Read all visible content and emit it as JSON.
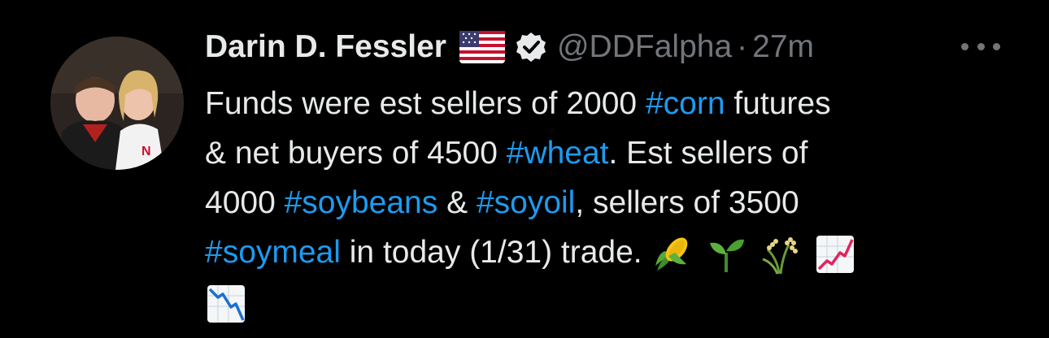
{
  "author": {
    "name": "Darin D. Fessler",
    "handle": "@DDFalpha",
    "separator": "·",
    "time": "27m"
  },
  "icons": {
    "flag": "us-flag-icon",
    "verified": "verified-badge-icon",
    "more": "more-options-icon",
    "emoji": [
      "ear-of-corn",
      "seedling",
      "sheaf-of-rice",
      "chart-increasing",
      "chart-decreasing"
    ]
  },
  "colors": {
    "background": "#000000",
    "text": "#e7e9ea",
    "secondary": "#71767b",
    "hashtag": "#1d9bf0"
  },
  "tweet": {
    "line1": {
      "text_a": "Funds were est sellers of 2000 ",
      "tag_a": "#corn",
      "text_b": " futures"
    },
    "line2": {
      "text_a": "& net buyers of 4500 ",
      "tag_a": "#wheat",
      "text_b": ". Est sellers of"
    },
    "line3": {
      "text_a": "4000 ",
      "tag_a": "#soybeans",
      "text_b": " & ",
      "tag_b": "#soyoil",
      "text_c": ", sellers of 3500"
    },
    "line4": {
      "tag_a": "#soymeal",
      "text_a": " in today (1/31) trade. "
    }
  }
}
